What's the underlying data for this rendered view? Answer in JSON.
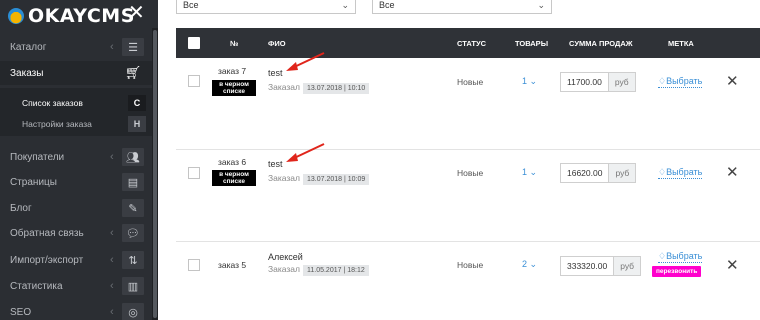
{
  "sidebar": {
    "logo_text": "OKAYCMS",
    "items": [
      {
        "label": "Каталог",
        "icon": "list-icon"
      },
      {
        "label": "Заказы",
        "icon": "cart-icon"
      },
      {
        "label": "Покупатели",
        "icon": "users-icon"
      },
      {
        "label": "Страницы",
        "icon": "page-icon"
      },
      {
        "label": "Блог",
        "icon": "pencil-icon"
      },
      {
        "label": "Обратная связь",
        "icon": "chat-icon"
      },
      {
        "label": "Импорт/экспорт",
        "icon": "updown-icon"
      },
      {
        "label": "Статистика",
        "icon": "bar-chart-icon"
      },
      {
        "label": "SEO",
        "icon": "target-icon"
      }
    ],
    "submenu": [
      {
        "label": "Список заказов",
        "badge": "C"
      },
      {
        "label": "Настройки заказа",
        "badge": "H"
      }
    ]
  },
  "filters": {
    "first": "Все",
    "second": "Все"
  },
  "table": {
    "headers": {
      "num": "№",
      "fio": "ФИО",
      "status": "СТАТУС",
      "goods": "ТОВАРЫ",
      "sum": "СУММА ПРОДАЖ",
      "tag": "МЕТКА"
    },
    "rows": [
      {
        "order": "заказ 7",
        "blacklist": "в черном списке",
        "name": "test",
        "ordered": "Заказал",
        "date": "13.07.2018 | 10:10",
        "status": "Новые",
        "qty": "1",
        "sum": "11700.00",
        "currency": "руб",
        "tag": "Выбрать",
        "badge": ""
      },
      {
        "order": "заказ 6",
        "blacklist": "в черном списке",
        "name": "test",
        "ordered": "Заказал",
        "date": "13.07.2018 | 10:09",
        "status": "Новые",
        "qty": "1",
        "sum": "16620.00",
        "currency": "руб",
        "tag": "Выбрать",
        "badge": ""
      },
      {
        "order": "заказ 5",
        "blacklist": "",
        "name": "Алексей",
        "ordered": "Заказал",
        "date": "11.05.2017 | 18:12",
        "status": "Новые",
        "qty": "2",
        "sum": "333320.00",
        "currency": "руб",
        "tag": "Выбрать",
        "badge": "перезвонить"
      }
    ]
  },
  "colors": {
    "sidebar_bg": "#2b2e33",
    "header_bg": "#2f3237",
    "link": "#3a8fd6",
    "badge": "#ff00cc",
    "arrow": "#e0251b"
  }
}
